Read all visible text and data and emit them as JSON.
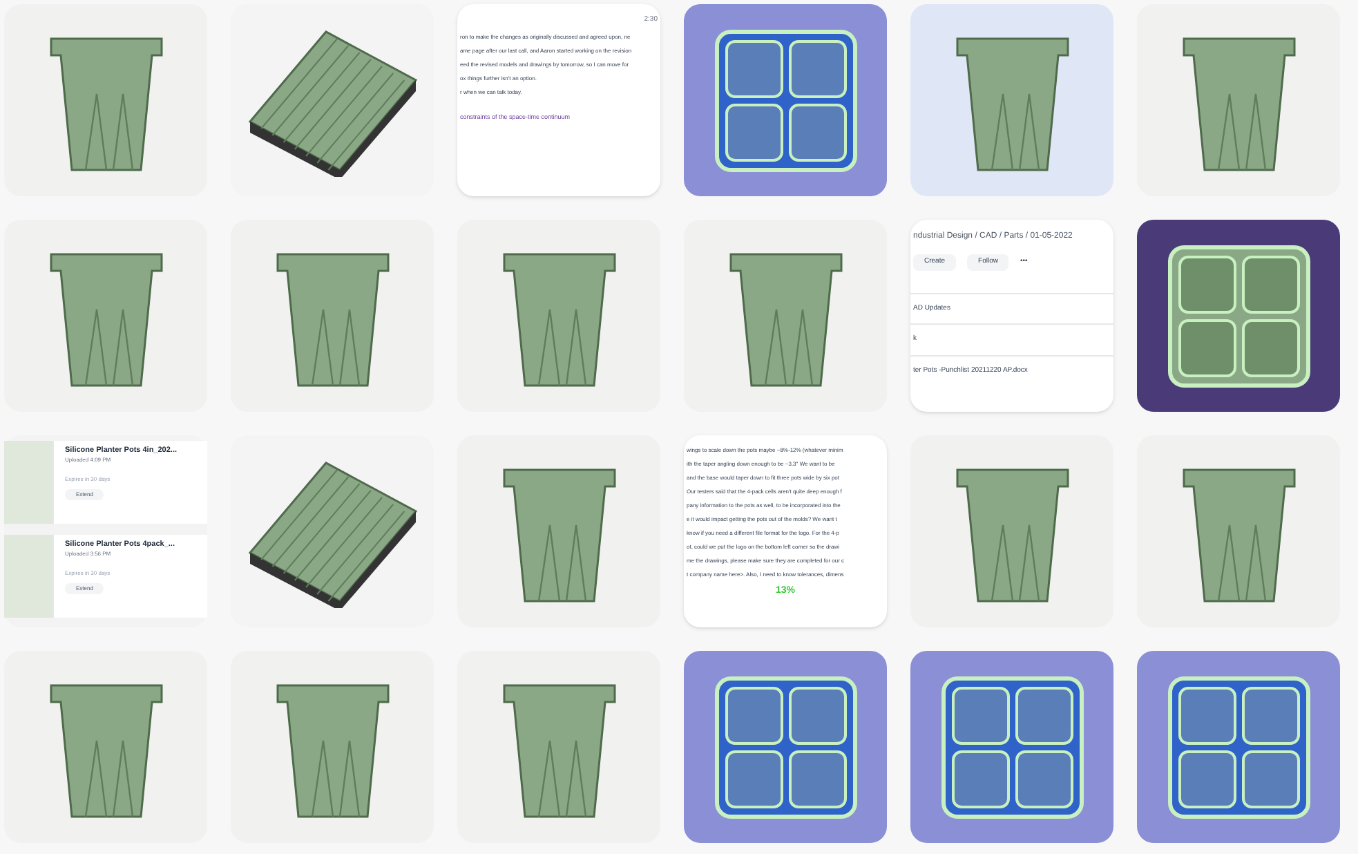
{
  "gallery": [
    {
      "kind": "pot"
    },
    {
      "kind": "tray"
    },
    {
      "kind": "doc",
      "time": "2:30",
      "lines": [
        "ron to make the changes as originally discussed and agreed upon, ne",
        "ame page after our last call, and Aaron started working on the revision",
        "eed the revised models and drawings by tomorrow, so I can move for",
        "ox things further isn't an option.",
        "r when we can talk today."
      ],
      "link": "constraints of the space-time continuum"
    },
    {
      "kind": "cells-blue"
    },
    {
      "kind": "pot-blue"
    },
    {
      "kind": "pot"
    },
    {
      "kind": "pot"
    },
    {
      "kind": "pot"
    },
    {
      "kind": "pot"
    },
    {
      "kind": "pot"
    },
    {
      "kind": "app",
      "breadcrumb": "ndustrial Design / CAD / Parts / 01-05-2022",
      "buttons": [
        "Create",
        "Follow",
        "•••"
      ],
      "rows": [
        "AD Updates",
        "k",
        "ter Pots -Punchlist 20211220 AP.docx"
      ]
    },
    {
      "kind": "cells-dark"
    },
    {
      "kind": "files",
      "files": [
        {
          "title": "Silicone Planter Pots 4in_202...",
          "uploaded": "Uploaded 4:09 PM",
          "expires": "Expires in 30 days",
          "action": "Extend"
        },
        {
          "title": "Silicone Planter Pots 4pack_...",
          "uploaded": "Uploaded 3:56 PM",
          "expires": "Expires in 30 days",
          "action": "Extend"
        }
      ]
    },
    {
      "kind": "tray"
    },
    {
      "kind": "pot"
    },
    {
      "kind": "doc",
      "lines": [
        "wings to scale down the pots maybe ~8%-12% (whatever minim",
        "ith the taper angling down enough to be ~3.3\" We want to be",
        "and the base would taper down to fit three pots wide by six pot",
        "Our testers said that the 4-pack cells aren't quite deep enough f",
        "pany information to the pots as well, to be incorporated into the",
        "e it would impact getting the pots out of the molds?  We want t",
        "know if you need a different file format for the logo.  For the 4-p",
        "ot, could we put the logo on the bottom left corner so the drawi",
        "me the drawings, please make sure they are completed for our c",
        "t company name here>.  Also, I need to know tolerances, dimens"
      ],
      "note": "13%"
    },
    {
      "kind": "pot"
    },
    {
      "kind": "pot"
    },
    {
      "kind": "pot"
    },
    {
      "kind": "pot"
    },
    {
      "kind": "pot"
    },
    {
      "kind": "cells-blue"
    },
    {
      "kind": "cells-blue"
    },
    {
      "kind": "cells-blue"
    }
  ]
}
